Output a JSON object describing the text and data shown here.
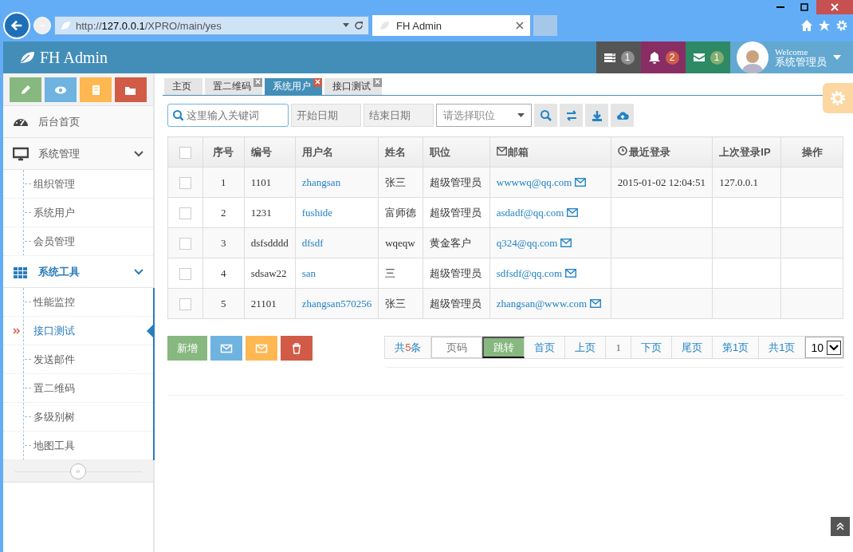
{
  "browser": {
    "url_prefix": "http://",
    "url_host": "127.0.0.1",
    "url_path": "/XPRO/main/yes",
    "tab_title": "FH Admin"
  },
  "navbar": {
    "brand": "FH Admin",
    "badges": [
      {
        "kind": "tasks",
        "count": "1",
        "color": "#555555"
      },
      {
        "kind": "bell",
        "count": "2",
        "color": "#892e65"
      },
      {
        "kind": "mail",
        "count": "1",
        "color": "#2e8965"
      }
    ],
    "welcome": "Welcome",
    "user": "系统管理员"
  },
  "shortcuts": [
    {
      "kind": "pencil",
      "color": "#87b87f"
    },
    {
      "kind": "eye",
      "color": "#6fb3e0"
    },
    {
      "kind": "book",
      "color": "#ffb752"
    },
    {
      "kind": "folder",
      "color": "#d15b47"
    }
  ],
  "sidebar": {
    "items": [
      {
        "label": "后台首页",
        "selected": false
      },
      {
        "label": "系统管理",
        "selected": false,
        "expanded": true,
        "children": [
          {
            "label": "组织管理",
            "selected": false
          },
          {
            "label": "系统用户",
            "selected": false
          },
          {
            "label": "会员管理",
            "selected": false
          }
        ]
      },
      {
        "label": "系统工具",
        "selected": true,
        "expanded": true,
        "children": [
          {
            "label": "性能监控",
            "selected": false
          },
          {
            "label": "接口测试",
            "selected": true
          },
          {
            "label": "发送邮件",
            "selected": false
          },
          {
            "label": "置二维码",
            "selected": false
          },
          {
            "label": "多级别树",
            "selected": false
          },
          {
            "label": "地图工具",
            "selected": false
          }
        ]
      }
    ]
  },
  "tabs": [
    {
      "label": "主页",
      "selected": false,
      "closable": false
    },
    {
      "label": "置二维码",
      "selected": false,
      "closable": true
    },
    {
      "label": "系统用户",
      "selected": true,
      "closable": true
    },
    {
      "label": "接口测试",
      "selected": false,
      "closable": true
    }
  ],
  "toolbar": {
    "search_placeholder": "这里输入关键词",
    "start_placeholder": "开始日期",
    "end_placeholder": "结束日期",
    "select_placeholder": "请选择职位",
    "buttons": [
      {
        "kind": "search"
      },
      {
        "kind": "exchange"
      },
      {
        "kind": "download"
      },
      {
        "kind": "upload"
      }
    ]
  },
  "table": {
    "select_all_checked": false,
    "columns": [
      {
        "kind": "check"
      },
      {
        "label": "序号",
        "kind": "plain"
      },
      {
        "label": "编号",
        "kind": "plain"
      },
      {
        "label": "用户名",
        "kind": "plain"
      },
      {
        "label": "姓名",
        "kind": "plain"
      },
      {
        "label": "职位",
        "kind": "plain"
      },
      {
        "label": "邮箱",
        "kind": "mail"
      },
      {
        "label": "最近登录",
        "kind": "clock"
      },
      {
        "label": "上次登录IP",
        "kind": "plain"
      },
      {
        "label": "操作",
        "kind": "plain"
      }
    ],
    "rows": [
      {
        "checked": false,
        "index": "1",
        "code": "1101",
        "username": "zhangsan",
        "name": "张三",
        "role": "超级管理员",
        "email": "wwwwq@qq.com",
        "last_login": "2015-01-02 12:04:51",
        "ip": "127.0.0.1"
      },
      {
        "checked": false,
        "index": "2",
        "code": "1231",
        "username": "fushide",
        "name": "富师德",
        "role": "超级管理员",
        "email": "asdadf@qq.com"
      },
      {
        "checked": false,
        "index": "3",
        "code": "dsfsdddd",
        "username": "dfsdf",
        "name": "wqeqw",
        "role": "黄金客户",
        "email": "q324@qq.com"
      },
      {
        "checked": false,
        "index": "4",
        "code": "sdsaw22",
        "username": "san",
        "name": "三",
        "role": "超级管理员",
        "email": "sdfsdf@qq.com"
      },
      {
        "checked": false,
        "index": "5",
        "code": "21101",
        "username": "zhangsan570256",
        "name": "张三",
        "role": "超级管理员",
        "email": "zhangsan@www.com"
      }
    ]
  },
  "actions": [
    {
      "kind": "text",
      "label": "新增",
      "color": "#87b87f"
    },
    {
      "kind": "mail",
      "color": "#6fb3e0"
    },
    {
      "kind": "mail",
      "color": "#ffb752"
    },
    {
      "kind": "trash",
      "color": "#d15b47"
    }
  ],
  "pagination": {
    "total": "共**5**条",
    "page_placeholder": "页码",
    "jump": "跳转",
    "first": "首页",
    "prev": "上页",
    "current": "1",
    "next": "下页",
    "last": "尾页",
    "page_of": "第1页",
    "pages": "共1页",
    "page_size": "10"
  }
}
